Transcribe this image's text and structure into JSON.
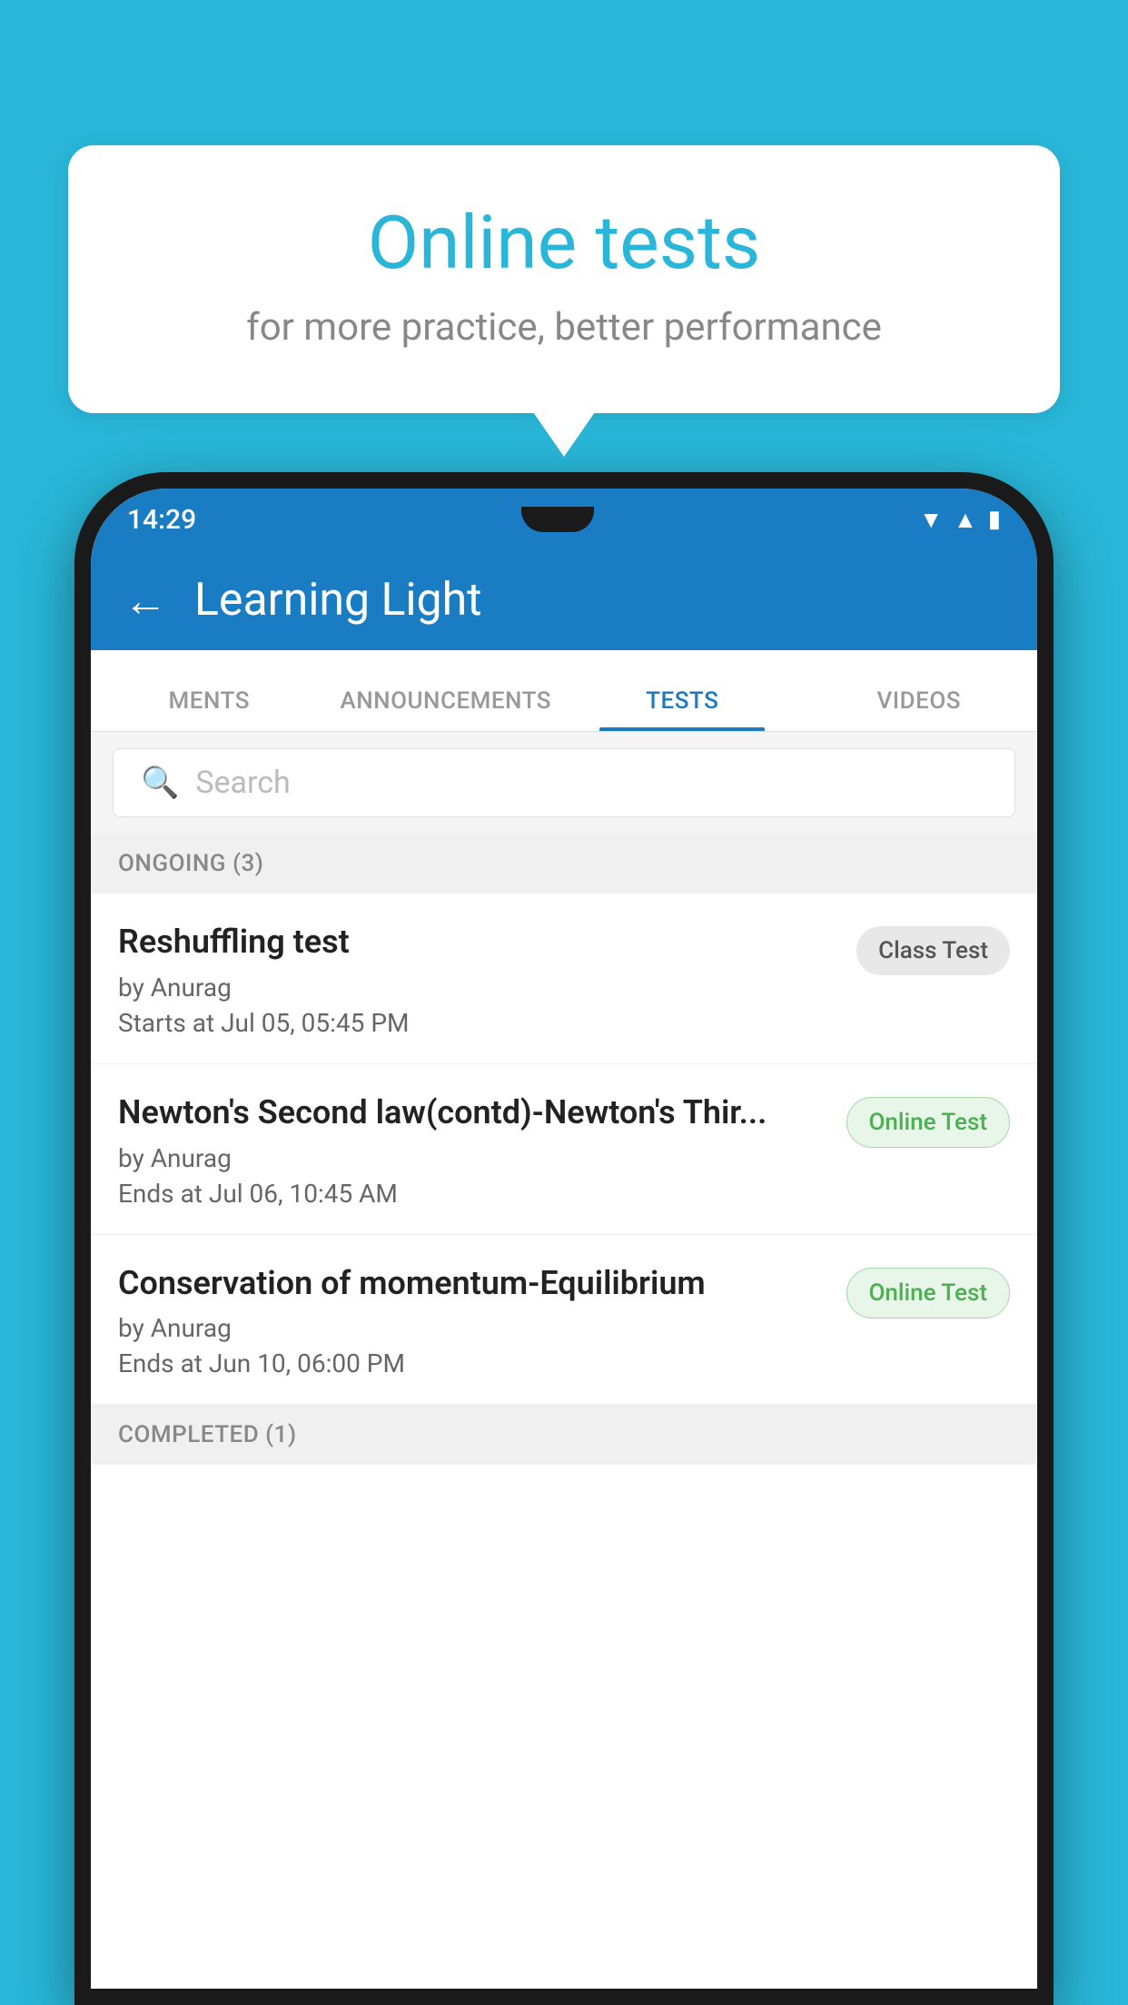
{
  "background": {
    "color": "#29b6d8"
  },
  "speech_bubble": {
    "title": "Online tests",
    "subtitle": "for more practice, better performance"
  },
  "phone": {
    "status_bar": {
      "time": "14:29"
    },
    "top_bar": {
      "title": "Learning Light",
      "back_label": "←"
    },
    "tabs": [
      {
        "label": "MENTS",
        "active": false
      },
      {
        "label": "ANNOUNCEMENTS",
        "active": false
      },
      {
        "label": "TESTS",
        "active": true
      },
      {
        "label": "VIDEOS",
        "active": false
      }
    ],
    "search": {
      "placeholder": "Search"
    },
    "ongoing_section": {
      "label": "ONGOING (3)"
    },
    "tests": [
      {
        "title": "Reshuffling test",
        "author": "by Anurag",
        "date": "Starts at  Jul 05, 05:45 PM",
        "badge": "Class Test",
        "badge_type": "class"
      },
      {
        "title": "Newton's Second law(contd)-Newton's Thir...",
        "author": "by Anurag",
        "date": "Ends at  Jul 06, 10:45 AM",
        "badge": "Online Test",
        "badge_type": "online"
      },
      {
        "title": "Conservation of momentum-Equilibrium",
        "author": "by Anurag",
        "date": "Ends at  Jun 10, 06:00 PM",
        "badge": "Online Test",
        "badge_type": "online"
      }
    ],
    "completed_section": {
      "label": "COMPLETED (1)"
    }
  }
}
